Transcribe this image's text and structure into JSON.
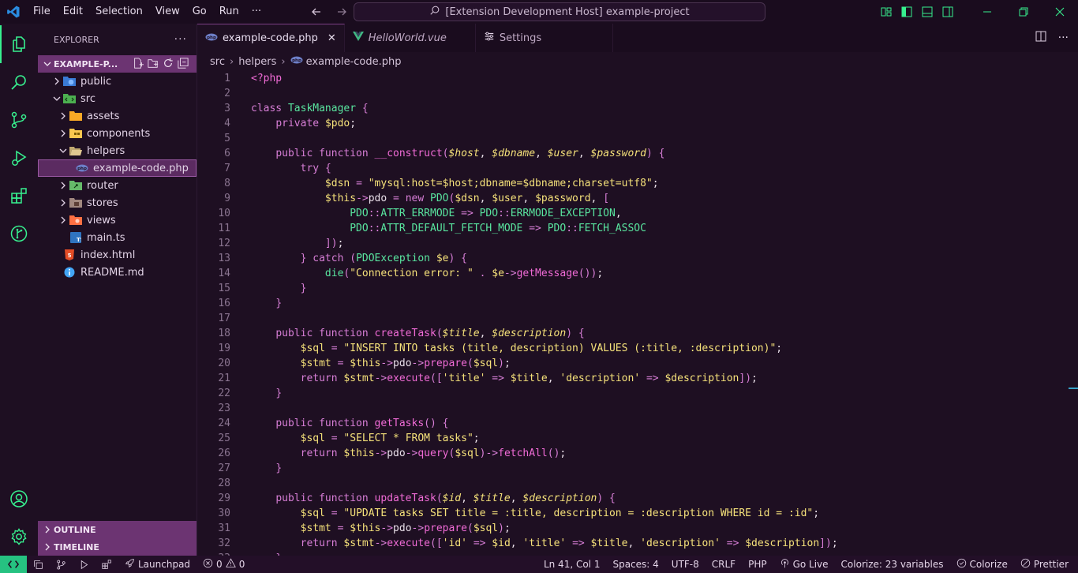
{
  "menu": [
    "File",
    "Edit",
    "Selection",
    "View",
    "Go",
    "Run",
    "···"
  ],
  "command_center": "[Extension Development Host] example-project",
  "explorer": {
    "title": "EXPLORER",
    "more": "···",
    "folder": "EXAMPLE-P...",
    "tree": [
      {
        "label": "public",
        "indent": 0,
        "chevron": "right",
        "icon": "globe-folder-icon"
      },
      {
        "label": "src",
        "indent": 0,
        "chevron": "down",
        "icon": "src-folder-icon"
      },
      {
        "label": "assets",
        "indent": 1,
        "chevron": "right",
        "icon": "assets-folder-icon"
      },
      {
        "label": "components",
        "indent": 1,
        "chevron": "right",
        "icon": "components-folder-icon"
      },
      {
        "label": "helpers",
        "indent": 1,
        "chevron": "down",
        "icon": "helpers-folder-icon"
      },
      {
        "label": "example-code.php",
        "indent": 2,
        "chevron": "none",
        "icon": "php-file-icon",
        "selected": true
      },
      {
        "label": "router",
        "indent": 1,
        "chevron": "right",
        "icon": "router-folder-icon"
      },
      {
        "label": "stores",
        "indent": 1,
        "chevron": "right",
        "icon": "stores-folder-icon"
      },
      {
        "label": "views",
        "indent": 1,
        "chevron": "right",
        "icon": "views-folder-icon"
      },
      {
        "label": "main.ts",
        "indent": 1,
        "chevron": "none",
        "icon": "typescript-file-icon"
      },
      {
        "label": "index.html",
        "indent": 0,
        "chevron": "none",
        "icon": "html-file-icon"
      },
      {
        "label": "README.md",
        "indent": 0,
        "chevron": "none",
        "icon": "info-file-icon"
      }
    ],
    "outline": "OUTLINE",
    "timeline": "TIMELINE"
  },
  "tabs": [
    {
      "label": "example-code.php",
      "active": true,
      "icon": "php-file-icon"
    },
    {
      "label": "HelloWorld.vue",
      "active": false,
      "icon": "vue-file-icon"
    },
    {
      "label": "Settings",
      "active": false,
      "icon": "settings-icon"
    }
  ],
  "breadcrumb": [
    "src",
    "helpers",
    "example-code.php"
  ],
  "code_lines": [
    [
      [
        "t-tag",
        "<?php"
      ]
    ],
    [],
    [
      [
        "t-kw",
        "class "
      ],
      [
        "t-cls",
        "TaskManager "
      ],
      [
        "t-punc",
        "{"
      ]
    ],
    [
      [
        "t-plain",
        "    "
      ],
      [
        "t-kw",
        "private "
      ],
      [
        "t-var",
        "$pdo"
      ],
      [
        "t-plain",
        ";"
      ]
    ],
    [],
    [
      [
        "t-plain",
        "    "
      ],
      [
        "t-kw",
        "public function "
      ],
      [
        "t-fn",
        "__construct"
      ],
      [
        "t-punc",
        "("
      ],
      [
        "t-param",
        "$host"
      ],
      [
        "t-plain",
        ", "
      ],
      [
        "t-param",
        "$dbname"
      ],
      [
        "t-plain",
        ", "
      ],
      [
        "t-param",
        "$user"
      ],
      [
        "t-plain",
        ", "
      ],
      [
        "t-param",
        "$password"
      ],
      [
        "t-punc",
        ") {"
      ]
    ],
    [
      [
        "t-plain",
        "        "
      ],
      [
        "t-kw",
        "try "
      ],
      [
        "t-punc",
        "{"
      ]
    ],
    [
      [
        "t-plain",
        "            "
      ],
      [
        "t-var",
        "$dsn "
      ],
      [
        "t-op",
        "= "
      ],
      [
        "t-str",
        "\"mysql:host=$host;dbname=$dbname;charset=utf8\""
      ],
      [
        "t-plain",
        ";"
      ]
    ],
    [
      [
        "t-plain",
        "            "
      ],
      [
        "t-var",
        "$this"
      ],
      [
        "t-op",
        "->"
      ],
      [
        "t-plain",
        "pdo "
      ],
      [
        "t-op",
        "= "
      ],
      [
        "t-kw",
        "new "
      ],
      [
        "t-cls",
        "PDO"
      ],
      [
        "t-punc",
        "("
      ],
      [
        "t-var",
        "$dsn"
      ],
      [
        "t-plain",
        ", "
      ],
      [
        "t-var",
        "$user"
      ],
      [
        "t-plain",
        ", "
      ],
      [
        "t-var",
        "$password"
      ],
      [
        "t-plain",
        ", "
      ],
      [
        "t-punc",
        "["
      ]
    ],
    [
      [
        "t-plain",
        "                "
      ],
      [
        "t-cls",
        "PDO"
      ],
      [
        "t-op",
        "::"
      ],
      [
        "t-cls",
        "ATTR_ERRMODE "
      ],
      [
        "t-op",
        "=> "
      ],
      [
        "t-cls",
        "PDO"
      ],
      [
        "t-op",
        "::"
      ],
      [
        "t-cls",
        "ERRMODE_EXCEPTION"
      ],
      [
        "t-plain",
        ","
      ]
    ],
    [
      [
        "t-plain",
        "                "
      ],
      [
        "t-cls",
        "PDO"
      ],
      [
        "t-op",
        "::"
      ],
      [
        "t-cls",
        "ATTR_DEFAULT_FETCH_MODE "
      ],
      [
        "t-op",
        "=> "
      ],
      [
        "t-cls",
        "PDO"
      ],
      [
        "t-op",
        "::"
      ],
      [
        "t-cls",
        "FETCH_ASSOC"
      ]
    ],
    [
      [
        "t-plain",
        "            "
      ],
      [
        "t-punc",
        "])"
      ],
      [
        "t-plain",
        ";"
      ]
    ],
    [
      [
        "t-plain",
        "        "
      ],
      [
        "t-punc",
        "} "
      ],
      [
        "t-kw",
        "catch "
      ],
      [
        "t-punc",
        "("
      ],
      [
        "t-cls",
        "PDOException "
      ],
      [
        "t-var",
        "$e"
      ],
      [
        "t-punc",
        ") {"
      ]
    ],
    [
      [
        "t-plain",
        "            "
      ],
      [
        "t-cls",
        "die"
      ],
      [
        "t-punc",
        "("
      ],
      [
        "t-str",
        "\"Connection error: \" "
      ],
      [
        "t-op",
        ". "
      ],
      [
        "t-var",
        "$e"
      ],
      [
        "t-op",
        "->"
      ],
      [
        "t-fn",
        "getMessage"
      ],
      [
        "t-punc",
        "())"
      ],
      [
        "t-plain",
        ";"
      ]
    ],
    [
      [
        "t-plain",
        "        "
      ],
      [
        "t-punc",
        "}"
      ]
    ],
    [
      [
        "t-plain",
        "    "
      ],
      [
        "t-punc",
        "}"
      ]
    ],
    [],
    [
      [
        "t-plain",
        "    "
      ],
      [
        "t-kw",
        "public function "
      ],
      [
        "t-fn",
        "createTask"
      ],
      [
        "t-punc",
        "("
      ],
      [
        "t-param",
        "$title"
      ],
      [
        "t-plain",
        ", "
      ],
      [
        "t-param",
        "$description"
      ],
      [
        "t-punc",
        ") {"
      ]
    ],
    [
      [
        "t-plain",
        "        "
      ],
      [
        "t-var",
        "$sql "
      ],
      [
        "t-op",
        "= "
      ],
      [
        "t-str",
        "\"INSERT INTO tasks (title, description) VALUES (:title, :description)\""
      ],
      [
        "t-plain",
        ";"
      ]
    ],
    [
      [
        "t-plain",
        "        "
      ],
      [
        "t-var",
        "$stmt "
      ],
      [
        "t-op",
        "= "
      ],
      [
        "t-var",
        "$this"
      ],
      [
        "t-op",
        "->"
      ],
      [
        "t-plain",
        "pdo"
      ],
      [
        "t-op",
        "->"
      ],
      [
        "t-fn",
        "prepare"
      ],
      [
        "t-punc",
        "("
      ],
      [
        "t-var",
        "$sql"
      ],
      [
        "t-punc",
        ")"
      ],
      [
        "t-plain",
        ";"
      ]
    ],
    [
      [
        "t-plain",
        "        "
      ],
      [
        "t-kw",
        "return "
      ],
      [
        "t-var",
        "$stmt"
      ],
      [
        "t-op",
        "->"
      ],
      [
        "t-fn",
        "execute"
      ],
      [
        "t-punc",
        "(["
      ],
      [
        "t-str",
        "'title' "
      ],
      [
        "t-op",
        "=> "
      ],
      [
        "t-var",
        "$title"
      ],
      [
        "t-plain",
        ", "
      ],
      [
        "t-str",
        "'description' "
      ],
      [
        "t-op",
        "=> "
      ],
      [
        "t-var",
        "$description"
      ],
      [
        "t-punc",
        "])"
      ],
      [
        "t-plain",
        ";"
      ]
    ],
    [
      [
        "t-plain",
        "    "
      ],
      [
        "t-punc",
        "}"
      ]
    ],
    [],
    [
      [
        "t-plain",
        "    "
      ],
      [
        "t-kw",
        "public function "
      ],
      [
        "t-fn",
        "getTasks"
      ],
      [
        "t-punc",
        "() {"
      ]
    ],
    [
      [
        "t-plain",
        "        "
      ],
      [
        "t-var",
        "$sql "
      ],
      [
        "t-op",
        "= "
      ],
      [
        "t-str",
        "\"SELECT * FROM tasks\""
      ],
      [
        "t-plain",
        ";"
      ]
    ],
    [
      [
        "t-plain",
        "        "
      ],
      [
        "t-kw",
        "return "
      ],
      [
        "t-var",
        "$this"
      ],
      [
        "t-op",
        "->"
      ],
      [
        "t-plain",
        "pdo"
      ],
      [
        "t-op",
        "->"
      ],
      [
        "t-fn",
        "query"
      ],
      [
        "t-punc",
        "("
      ],
      [
        "t-var",
        "$sql"
      ],
      [
        "t-punc",
        ")"
      ],
      [
        "t-op",
        "->"
      ],
      [
        "t-fn",
        "fetchAll"
      ],
      [
        "t-punc",
        "()"
      ],
      [
        "t-plain",
        ";"
      ]
    ],
    [
      [
        "t-plain",
        "    "
      ],
      [
        "t-punc",
        "}"
      ]
    ],
    [],
    [
      [
        "t-plain",
        "    "
      ],
      [
        "t-kw",
        "public function "
      ],
      [
        "t-fn",
        "updateTask"
      ],
      [
        "t-punc",
        "("
      ],
      [
        "t-param",
        "$id"
      ],
      [
        "t-plain",
        ", "
      ],
      [
        "t-param",
        "$title"
      ],
      [
        "t-plain",
        ", "
      ],
      [
        "t-param",
        "$description"
      ],
      [
        "t-punc",
        ") {"
      ]
    ],
    [
      [
        "t-plain",
        "        "
      ],
      [
        "t-var",
        "$sql "
      ],
      [
        "t-op",
        "= "
      ],
      [
        "t-str",
        "\"UPDATE tasks SET title = :title, description = :description WHERE id = :id\""
      ],
      [
        "t-plain",
        ";"
      ]
    ],
    [
      [
        "t-plain",
        "        "
      ],
      [
        "t-var",
        "$stmt "
      ],
      [
        "t-op",
        "= "
      ],
      [
        "t-var",
        "$this"
      ],
      [
        "t-op",
        "->"
      ],
      [
        "t-plain",
        "pdo"
      ],
      [
        "t-op",
        "->"
      ],
      [
        "t-fn",
        "prepare"
      ],
      [
        "t-punc",
        "("
      ],
      [
        "t-var",
        "$sql"
      ],
      [
        "t-punc",
        ")"
      ],
      [
        "t-plain",
        ";"
      ]
    ],
    [
      [
        "t-plain",
        "        "
      ],
      [
        "t-kw",
        "return "
      ],
      [
        "t-var",
        "$stmt"
      ],
      [
        "t-op",
        "->"
      ],
      [
        "t-fn",
        "execute"
      ],
      [
        "t-punc",
        "(["
      ],
      [
        "t-str",
        "'id' "
      ],
      [
        "t-op",
        "=> "
      ],
      [
        "t-var",
        "$id"
      ],
      [
        "t-plain",
        ", "
      ],
      [
        "t-str",
        "'title' "
      ],
      [
        "t-op",
        "=> "
      ],
      [
        "t-var",
        "$title"
      ],
      [
        "t-plain",
        ", "
      ],
      [
        "t-str",
        "'description' "
      ],
      [
        "t-op",
        "=> "
      ],
      [
        "t-var",
        "$description"
      ],
      [
        "t-punc",
        "])"
      ],
      [
        "t-plain",
        ";"
      ]
    ],
    [
      [
        "t-plain",
        "    "
      ],
      [
        "t-punc",
        "}"
      ]
    ]
  ],
  "status": {
    "launchpad": "Launchpad",
    "problems_errors": "0",
    "problems_warnings": "0",
    "cursor": "Ln 41, Col 1",
    "spaces": "Spaces: 4",
    "encoding": "UTF-8",
    "eol": "CRLF",
    "language": "PHP",
    "go_live": "Go Live",
    "colorize_vars": "Colorize: 23 variables",
    "colorize": "Colorize",
    "prettier": "Prettier"
  },
  "colors": {
    "accent_green": "#37f08f",
    "folder_header": "#6c3472",
    "background": "#1e0f22"
  }
}
